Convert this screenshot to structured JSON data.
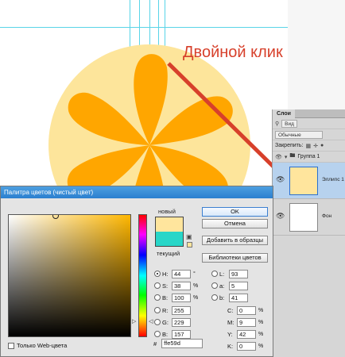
{
  "annotation": {
    "text": "Двойной клик"
  },
  "colors": {
    "accent_red": "#d7402b",
    "orange_main": "#ffa600",
    "orange_light": "#fde59b",
    "new_color": "#ffe59d",
    "current_color": "#28d6c8",
    "guide": "#59d4e8"
  },
  "layers_panel": {
    "tab": "Слои",
    "filter": "Вид",
    "blend_mode": "Обычные",
    "lock_label": "Закрепить:",
    "group_name": "Группа 1",
    "layers": [
      {
        "name": "Эллипс 1",
        "selected": true
      },
      {
        "name": "Фон",
        "selected": false
      }
    ]
  },
  "color_picker": {
    "title": "Палитра цветов (чистый цвет)",
    "new_label": "новый",
    "current_label": "текущий",
    "buttons": {
      "ok": "OK",
      "cancel": "Отмена",
      "add_swatch": "Добавить в образцы",
      "libraries": "Библиотеки цветов"
    },
    "hsb": [
      {
        "label": "H:",
        "value": "44",
        "unit": "°",
        "selected": true
      },
      {
        "label": "S:",
        "value": "38",
        "unit": "%",
        "selected": false
      },
      {
        "label": "B:",
        "value": "100",
        "unit": "%",
        "selected": false
      }
    ],
    "rgb": [
      {
        "label": "R:",
        "value": "255"
      },
      {
        "label": "G:",
        "value": "229"
      },
      {
        "label": "B:",
        "value": "157"
      }
    ],
    "lab": [
      {
        "label": "L:",
        "value": "93"
      },
      {
        "label": "a:",
        "value": "5"
      },
      {
        "label": "b:",
        "value": "41"
      }
    ],
    "cmyk": [
      {
        "label": "C:",
        "value": "0",
        "unit": "%"
      },
      {
        "label": "M:",
        "value": "9",
        "unit": "%"
      },
      {
        "label": "Y:",
        "value": "42",
        "unit": "%"
      },
      {
        "label": "K:",
        "value": "0",
        "unit": "%"
      }
    ],
    "hex_label": "#",
    "hex": "ffe59d",
    "web_only": "Только Web-цвета"
  }
}
